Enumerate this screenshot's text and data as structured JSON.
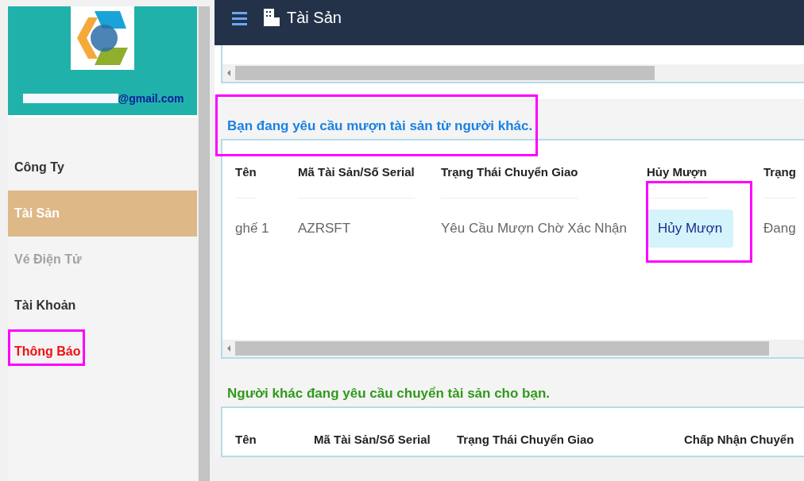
{
  "sidebar": {
    "email": "@gmail.com",
    "items": [
      {
        "label": "Công Ty",
        "selected": false,
        "disabled": false,
        "alert": false
      },
      {
        "label": "Tài Sản",
        "selected": true,
        "disabled": false,
        "alert": false
      },
      {
        "label": "Vé Điện Tử",
        "selected": false,
        "disabled": true,
        "alert": false
      },
      {
        "label": "Tài Khoản",
        "selected": false,
        "disabled": false,
        "alert": false
      },
      {
        "label": "Thông Báo",
        "selected": false,
        "disabled": false,
        "alert": true
      }
    ]
  },
  "header": {
    "title": "Tài Sản"
  },
  "sections": [
    {
      "title": "Bạn đang yêu cầu mượn tài sản từ người khác.",
      "color": "#1a82e2",
      "columns": [
        "Tên",
        "Mã Tài Sản/Số Serial",
        "Trạng Thái Chuyển Giao",
        "Hủy Mượn",
        "Trạng"
      ],
      "rows": [
        {
          "cells": [
            "ghế 1",
            "AZRSFT",
            "Yêu Cầu Mượn Chờ Xác Nhận"
          ],
          "action": "Hủy Mượn",
          "column_5": "Đang"
        }
      ]
    },
    {
      "title": "Người khác đang yêu cầu chuyển tài sản cho bạn.",
      "color": "#2f9a1a",
      "columns": [
        "Tên",
        "Mã Tài Sản/Số Serial",
        "Trạng Thái Chuyển Giao",
        "Chấp Nhận Chuyển"
      ]
    }
  ]
}
